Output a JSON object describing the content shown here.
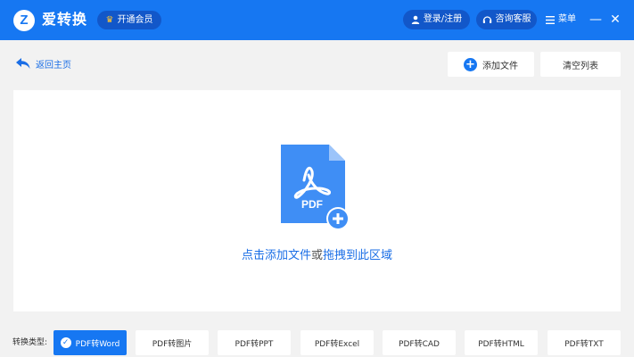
{
  "header": {
    "logo_letter": "Z",
    "app_name": "爱转换",
    "vip_label": "开通会员",
    "login_label": "登录/注册",
    "service_label": "咨询客服",
    "menu_label": "菜单",
    "minimize_glyph": "—",
    "close_glyph": "✕"
  },
  "toolbar": {
    "back_label": "返回主页",
    "add_file_label": "添加文件",
    "clear_list_label": "清空列表"
  },
  "drop_zone": {
    "icon_text": "PDF",
    "hint_part1": "点击添加文件",
    "hint_part2": "或",
    "hint_part3": "拖拽到此区域"
  },
  "conversion": {
    "label": "转换类型:",
    "types": [
      {
        "label": "PDF转Word",
        "active": true
      },
      {
        "label": "PDF转图片",
        "active": false
      },
      {
        "label": "PDF转PPT",
        "active": false
      },
      {
        "label": "PDF转Excel",
        "active": false
      },
      {
        "label": "PDF转CAD",
        "active": false
      },
      {
        "label": "PDF转HTML",
        "active": false
      },
      {
        "label": "PDF转TXT",
        "active": false
      }
    ]
  },
  "colors": {
    "brand_blue": "#1677f2",
    "header_pill": "#1257c9",
    "link_blue": "#1a6ee6",
    "background": "#f2f2f2"
  }
}
